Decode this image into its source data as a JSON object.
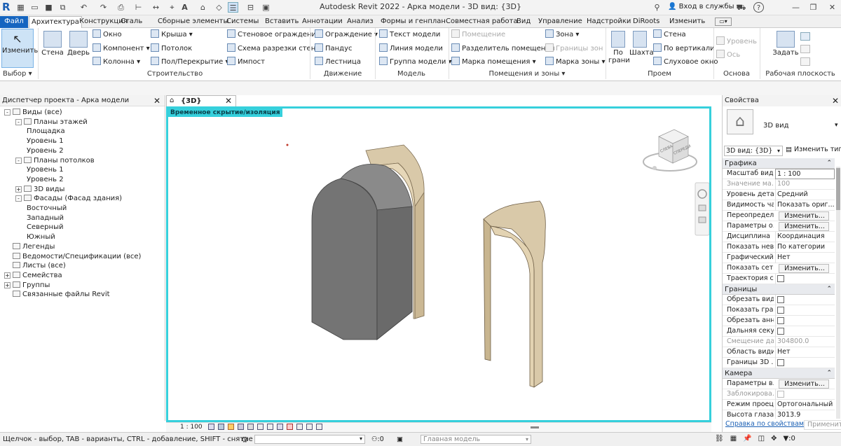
{
  "titlebar": {
    "title": "Autodesk Revit 2022 - Арка модели - 3D вид: {3D}",
    "signin": "Вход в службы",
    "help": "?",
    "qa_icons": [
      "revit-logo-icon",
      "open-icon",
      "save-icon",
      "sync-icon",
      "undo-icon",
      "redo-icon",
      "print-icon",
      "measure-icon",
      "dimension-icon",
      "tag-icon",
      "text-icon",
      "view-3d-icon",
      "section-icon",
      "thin-lines-icon",
      "close-hidden-icon",
      "switch-windows-icon"
    ]
  },
  "tabs": [
    "Файл",
    "Архитектура",
    "Конструкция",
    "Сталь",
    "Сборные элементы",
    "Системы",
    "Вставить",
    "Аннотации",
    "Анализ",
    "Формы и генплан",
    "Совместная работа",
    "Вид",
    "Управление",
    "Надстройки",
    "DiRoots",
    "Изменить"
  ],
  "ribbon": {
    "modify": "Изменить",
    "select_panel": "Выбор",
    "wall": "Стена",
    "door": "Дверь",
    "build_items": [
      "Окно",
      "Компонент",
      "Колонна",
      "Крыша",
      "Потолок",
      "Пол/Перекрытие",
      "Стеновое ограждение",
      "Схема разрезки стены",
      "Импост"
    ],
    "build_panel": "Строительство",
    "move_items": [
      "Ограждение",
      "Пандус",
      "Лестница"
    ],
    "move_panel": "Движение",
    "model_items": [
      "Текст модели",
      "Линия модели",
      "Группа модели"
    ],
    "model_panel": "Модель",
    "room_items": [
      "Помещение",
      "Разделитель помещений",
      "Марка помещения",
      "Зона",
      "Границы зон",
      "Марка зоны"
    ],
    "room_panel": "Помещения и зоны",
    "opening_big": [
      "По грани",
      "Шахта"
    ],
    "opening_items": [
      "Стена",
      "По вертикали",
      "Слуховое окно"
    ],
    "opening_panel": "Проем",
    "datum_items": [
      "Уровень",
      "Ось"
    ],
    "datum_panel": "Основа",
    "wp_big": "Задать",
    "wp_panel": "Рабочая плоскость"
  },
  "project_browser": {
    "title": "Диспетчер проекта - Арка модели",
    "tree": [
      {
        "label": "Виды (все)",
        "level": 0,
        "exp": "-"
      },
      {
        "label": "Планы этажей",
        "level": 1,
        "exp": "-"
      },
      {
        "label": "Площадка",
        "level": 2,
        "exp": ""
      },
      {
        "label": "Уровень 1",
        "level": 2,
        "exp": ""
      },
      {
        "label": "Уровень 2",
        "level": 2,
        "exp": ""
      },
      {
        "label": "Планы потолков",
        "level": 1,
        "exp": "-"
      },
      {
        "label": "Уровень 1",
        "level": 2,
        "exp": ""
      },
      {
        "label": "Уровень 2",
        "level": 2,
        "exp": ""
      },
      {
        "label": "3D виды",
        "level": 1,
        "exp": "+"
      },
      {
        "label": "Фасады (Фасад здания)",
        "level": 1,
        "exp": "-"
      },
      {
        "label": "Восточный",
        "level": 2,
        "exp": ""
      },
      {
        "label": "Западный",
        "level": 2,
        "exp": ""
      },
      {
        "label": "Северный",
        "level": 2,
        "exp": ""
      },
      {
        "label": "Южный",
        "level": 2,
        "exp": ""
      },
      {
        "label": "Легенды",
        "level": 0,
        "exp": ""
      },
      {
        "label": "Ведомости/Спецификации (все)",
        "level": 0,
        "exp": ""
      },
      {
        "label": "Листы (все)",
        "level": 0,
        "exp": ""
      },
      {
        "label": "Семейства",
        "level": 0,
        "exp": "+"
      },
      {
        "label": "Группы",
        "level": 0,
        "exp": "+"
      },
      {
        "label": "Связанные файлы Revit",
        "level": 0,
        "exp": ""
      }
    ]
  },
  "view": {
    "tab_label": "{3D}",
    "banner": "Временное скрытие/изоляция",
    "scale": "1 : 100",
    "viewcube_labels": [
      "СЛЕВА",
      "СПЕРЕДИ"
    ]
  },
  "properties": {
    "title": "Свойства",
    "type_name": "3D вид",
    "selector": "3D вид: {3D}",
    "edit_type": "Изменить тип",
    "sections": [
      {
        "name": "Графика",
        "rows": [
          {
            "k": "Масштаб вида",
            "v": "1 : 100",
            "t": "input"
          },
          {
            "k": "Значение ма...",
            "v": "100",
            "t": "dim"
          },
          {
            "k": "Уровень дета...",
            "v": "Средний",
            "t": "text"
          },
          {
            "k": "Видимость ча...",
            "v": "Показать ориг...",
            "t": "text"
          },
          {
            "k": "Переопредел...",
            "v": "Изменить...",
            "t": "btn"
          },
          {
            "k": "Параметры о...",
            "v": "Изменить...",
            "t": "btn"
          },
          {
            "k": "Дисциплина",
            "v": "Координация",
            "t": "text"
          },
          {
            "k": "Показать нев...",
            "v": "По категории",
            "t": "text"
          },
          {
            "k": "Графический ...",
            "v": "Нет",
            "t": "text"
          },
          {
            "k": "Показать сетки",
            "v": "Изменить...",
            "t": "btn"
          },
          {
            "k": "Траектория с...",
            "v": "",
            "t": "cb"
          }
        ]
      },
      {
        "name": "Границы",
        "rows": [
          {
            "k": "Обрезать вид",
            "v": "",
            "t": "cb"
          },
          {
            "k": "Показать гра...",
            "v": "",
            "t": "cb"
          },
          {
            "k": "Обрезать анн...",
            "v": "",
            "t": "cb"
          },
          {
            "k": "Дальняя секу...",
            "v": "",
            "t": "cb"
          },
          {
            "k": "Смещение да...",
            "v": "304800.0",
            "t": "dim"
          },
          {
            "k": "Область види...",
            "v": "Нет",
            "t": "text"
          },
          {
            "k": "Границы 3D ...",
            "v": "",
            "t": "cb"
          }
        ]
      },
      {
        "name": "Камера",
        "rows": [
          {
            "k": "Параметры в...",
            "v": "Изменить...",
            "t": "btn"
          },
          {
            "k": "Заблокирова...",
            "v": "",
            "t": "cbdim"
          },
          {
            "k": "Режим проец...",
            "v": "Ортогональный",
            "t": "text"
          },
          {
            "k": "Высота глаза ...",
            "v": "3013.9",
            "t": "text"
          }
        ]
      }
    ],
    "help_link": "Справка по свойствам",
    "apply": "Применить"
  },
  "statusbar": {
    "hint": "Щелчок - выбор, TAB - варианты, CTRL - добавление, SHIFT - снятие выбора.",
    "worksets": ":0",
    "model": "Главная модель",
    "filter": ":0"
  }
}
